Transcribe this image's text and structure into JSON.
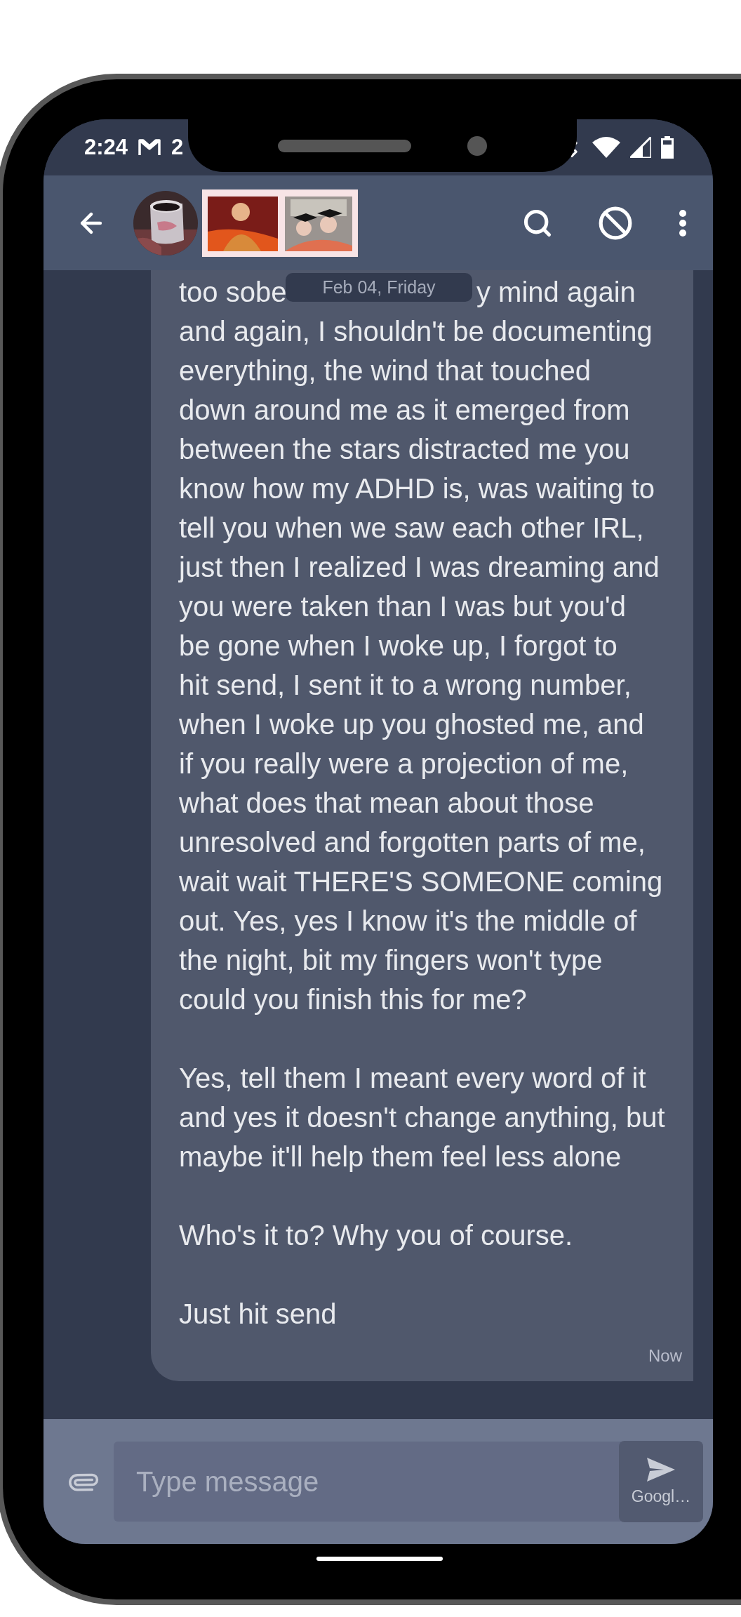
{
  "status_bar": {
    "time": "2:24",
    "notification_count": "2"
  },
  "date_chip": "Feb 04, Friday",
  "message": {
    "cut_line": {
      "left": "too sobe",
      "right": "y mind again"
    },
    "paragraphs": [
      "and again, I shouldn't be documenting\neverything, the wind that touched\ndown around me as it emerged from\nbetween the stars distracted me you\nknow how my ADHD is, was waiting to\ntell you when we saw each other IRL,\njust then I realized I was dreaming and\nyou were taken than I was but you'd\nbe gone when I woke up, I forgot to\nhit send, I sent it to a wrong number,\nwhen I woke up you ghosted me, and\nif you really were a projection of me,\nwhat does that mean about those\nunresolved and forgotten parts of me,\nwait wait THERE'S SOMEONE coming\nout. Yes, yes I know it's the middle of\nthe night, bit my fingers won't type\ncould you finish this for me?",
      "Yes, tell them I meant every word of it\nand yes it doesn't change anything, but\nmaybe it'll help them feel less alone",
      "Who's it to? Why you of course.",
      "Just hit send"
    ],
    "time": "Now"
  },
  "composer": {
    "placeholder": "Type message",
    "send_label": "Googl…"
  }
}
